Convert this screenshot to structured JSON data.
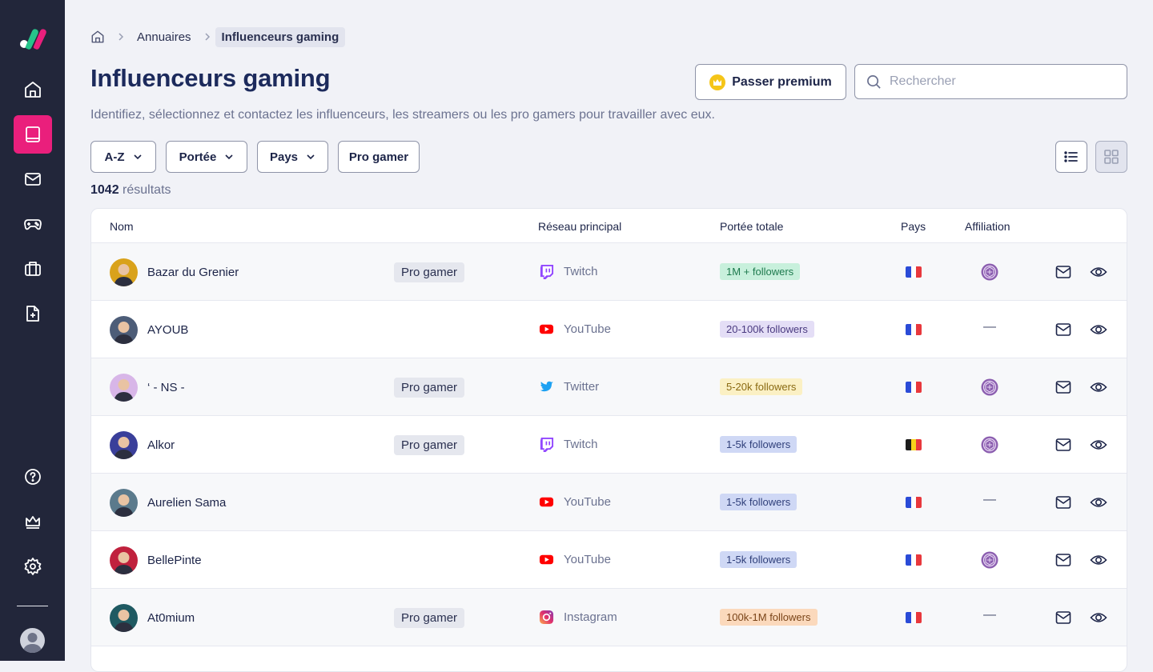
{
  "sidebar": {
    "items": [
      {
        "icon": "home-icon",
        "active": false
      },
      {
        "icon": "book-icon",
        "active": true
      },
      {
        "icon": "mail-icon",
        "active": false
      },
      {
        "icon": "gamepad-icon",
        "active": false
      },
      {
        "icon": "briefcase-icon",
        "active": false
      },
      {
        "icon": "file-plus-icon",
        "active": false
      },
      {
        "icon": "help-icon",
        "active": false
      },
      {
        "icon": "crown-icon",
        "active": false
      },
      {
        "icon": "gear-icon",
        "active": false
      }
    ],
    "accent": "#ea1f7c"
  },
  "breadcrumb": {
    "parent": "Annuaires",
    "current": "Influenceurs gaming"
  },
  "header": {
    "title": "Influenceurs gaming",
    "subtitle": "Identifiez, sélectionnez et contactez les influenceurs, les streamers ou les pro gamers pour travailler avec eux.",
    "premium_label": "Passer premium",
    "search_placeholder": "Rechercher"
  },
  "filters": {
    "sort": "A-Z",
    "reach": "Portée",
    "country": "Pays",
    "pro": "Pro gamer"
  },
  "results": {
    "count": "1042",
    "label": " résultats"
  },
  "table": {
    "columns": {
      "name": "Nom",
      "network": "Réseau principal",
      "reach": "Portée totale",
      "country": "Pays",
      "affiliation": "Affiliation"
    },
    "rows": [
      {
        "name": "Bazar du Grenier",
        "tag": "Pro gamer",
        "network": "Twitch",
        "reach": "1M + followers",
        "reach_color": "green",
        "flag": "fr",
        "affiliated": true
      },
      {
        "name": "AYOUB",
        "tag": "",
        "network": "YouTube",
        "reach": "20-100k followers",
        "reach_color": "purple",
        "flag": "fr",
        "affiliated": false
      },
      {
        "name": "‘ - NS -",
        "tag": "Pro gamer",
        "network": "Twitter",
        "reach": "5-20k followers",
        "reach_color": "yellow",
        "flag": "fr",
        "affiliated": true
      },
      {
        "name": "Alkor",
        "tag": "Pro gamer",
        "network": "Twitch",
        "reach": "1-5k followers",
        "reach_color": "blue",
        "flag": "be",
        "affiliated": true
      },
      {
        "name": "Aurelien Sama",
        "tag": "",
        "network": "YouTube",
        "reach": "1-5k followers",
        "reach_color": "blue",
        "flag": "fr",
        "affiliated": false
      },
      {
        "name": "BellePinte",
        "tag": "",
        "network": "YouTube",
        "reach": "1-5k followers",
        "reach_color": "blue",
        "flag": "fr",
        "affiliated": true
      },
      {
        "name": "At0mium",
        "tag": "Pro gamer",
        "network": "Instagram",
        "reach": "100k-1M followers",
        "reach_color": "orange",
        "flag": "fr",
        "affiliated": false
      }
    ],
    "dash": "—"
  }
}
